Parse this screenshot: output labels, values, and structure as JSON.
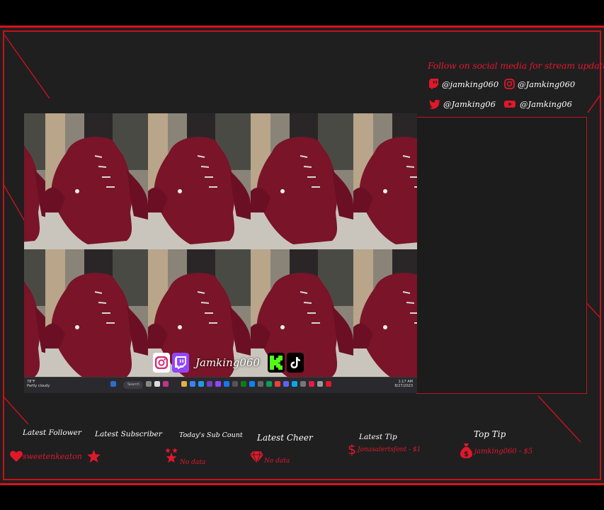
{
  "social": {
    "title": "Follow on social media for stream updates",
    "twitch": "@jamking060",
    "instagram": "@Jamking060",
    "twitter": "@Jamking06",
    "youtube": "@Jamking06"
  },
  "channel": {
    "name": "Jamking060"
  },
  "taskbar": {
    "weather_temp": "78°F",
    "weather_desc": "Partly cloudy",
    "search": "Search",
    "time": "1:17 AM",
    "date": "8/27/2023"
  },
  "stats": {
    "latest_follower_label": "Latest Follower",
    "latest_follower_value": "sweetenkeaton",
    "latest_subscriber_label": "Latest Subscriber",
    "sub_count_label": "Today's Sub Count",
    "sub_count_value": "No data",
    "latest_cheer_label": "Latest Cheer",
    "latest_cheer_value": "No data",
    "latest_tip_label": "Latest Tip",
    "latest_tip_value": "Jonasalertsfont - $1",
    "top_tip_label": "Top Tip",
    "top_tip_value": "jamking060 - $5"
  },
  "colors": {
    "accent": "#e0182a",
    "frame": "#1f1f20",
    "shoe": "#7a1428"
  },
  "icons": [
    "twitch-icon",
    "instagram-icon",
    "twitter-icon",
    "youtube-icon",
    "kick-icon",
    "tiktok-icon",
    "heart-icon",
    "star-icon",
    "stars-icon",
    "diamond-icon",
    "dollar-icon",
    "money-bag-icon"
  ]
}
